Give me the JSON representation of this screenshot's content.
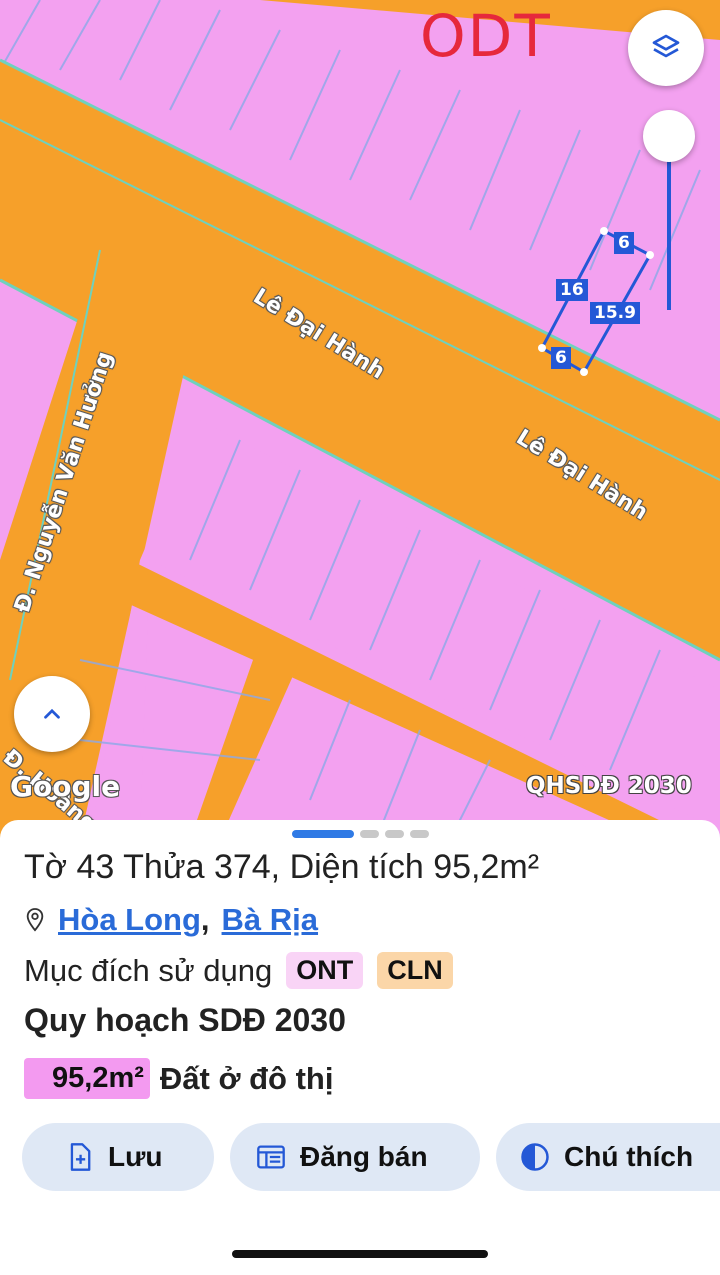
{
  "map": {
    "zone_code": "ODT",
    "roads": {
      "main_1": "Lê Đại Hành",
      "main_2": "Lê Đại Hành",
      "side": "Đ. Nguyễn Văn Hưởng",
      "bottom": "Đ. Hoàng V"
    },
    "dimensions": {
      "top": "6",
      "left": "16",
      "right": "15.9",
      "bottom": "6"
    },
    "attribution": "Google",
    "layer_label": "QHSDĐ 2030",
    "colors": {
      "residential": "#f3a1f0",
      "road": "#f6a02a",
      "parcel_line": "#6fd1bd",
      "highlight": "#2458d6"
    }
  },
  "sheet": {
    "title": "Tờ 43 Thửa 374, Diện tích 95,2m²",
    "location": {
      "ward": "Hòa Long",
      "separator": ",",
      "city": "Bà Rịa"
    },
    "purpose_label": "Mục đích sử dụng",
    "purpose_codes": [
      {
        "code": "ONT",
        "color": "#f9d4f6"
      },
      {
        "code": "CLN",
        "color": "#fbd6a8"
      }
    ],
    "plan_title": "Quy hoạch SDĐ 2030",
    "plan_area": "95,2m²",
    "plan_desc": "Đất ở đô thị",
    "actions": [
      {
        "label": "Lưu",
        "icon": "file-add-icon"
      },
      {
        "label": "Đăng bán",
        "icon": "list-icon"
      },
      {
        "label": "Chú thích",
        "icon": "half-circle-icon"
      }
    ]
  }
}
